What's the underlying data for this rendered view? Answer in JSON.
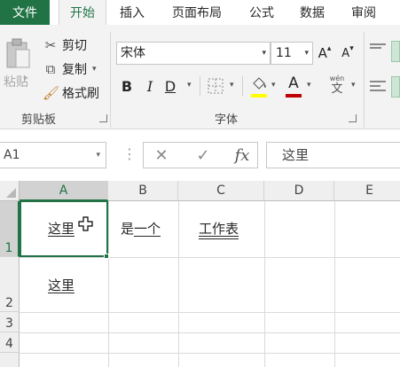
{
  "tabs": {
    "file": "文件",
    "items": [
      "开始",
      "插入",
      "页面布局",
      "公式",
      "数据",
      "审阅"
    ],
    "active": "开始"
  },
  "clipboard": {
    "paste": "粘贴",
    "cut": "剪切",
    "copy": "复制",
    "format_painter": "格式刷",
    "group_label": "剪贴板"
  },
  "font": {
    "name": "宋体",
    "size": "11",
    "grow": "A",
    "shrink": "A",
    "bold": "B",
    "italic": "I",
    "underline": "D",
    "highlight_glyph": "ab",
    "font_color_glyph": "A",
    "phonetic_top": "wén",
    "phonetic_bottom": "文",
    "group_label": "字体",
    "accent_colors": {
      "highlight": "#ffff00",
      "font_color": "#c00000"
    }
  },
  "formula_bar": {
    "name_box": "A1",
    "cancel": "✕",
    "enter": "✓",
    "fx": "fx",
    "value": "这里"
  },
  "sheet": {
    "columns": [
      "A",
      "B",
      "C",
      "D",
      "E"
    ],
    "rows": [
      "1",
      "2",
      "3",
      "4"
    ],
    "cells": {
      "A1": "这里",
      "B1_plain": "是",
      "B1_underlined": "一个",
      "C1": "工作表",
      "A2": "这里"
    },
    "selected": "A1"
  },
  "colors": {
    "accent": "#217346",
    "ribbon_bg": "#f3f3f3",
    "header_bg": "#efefef",
    "gridline": "#dadada"
  }
}
